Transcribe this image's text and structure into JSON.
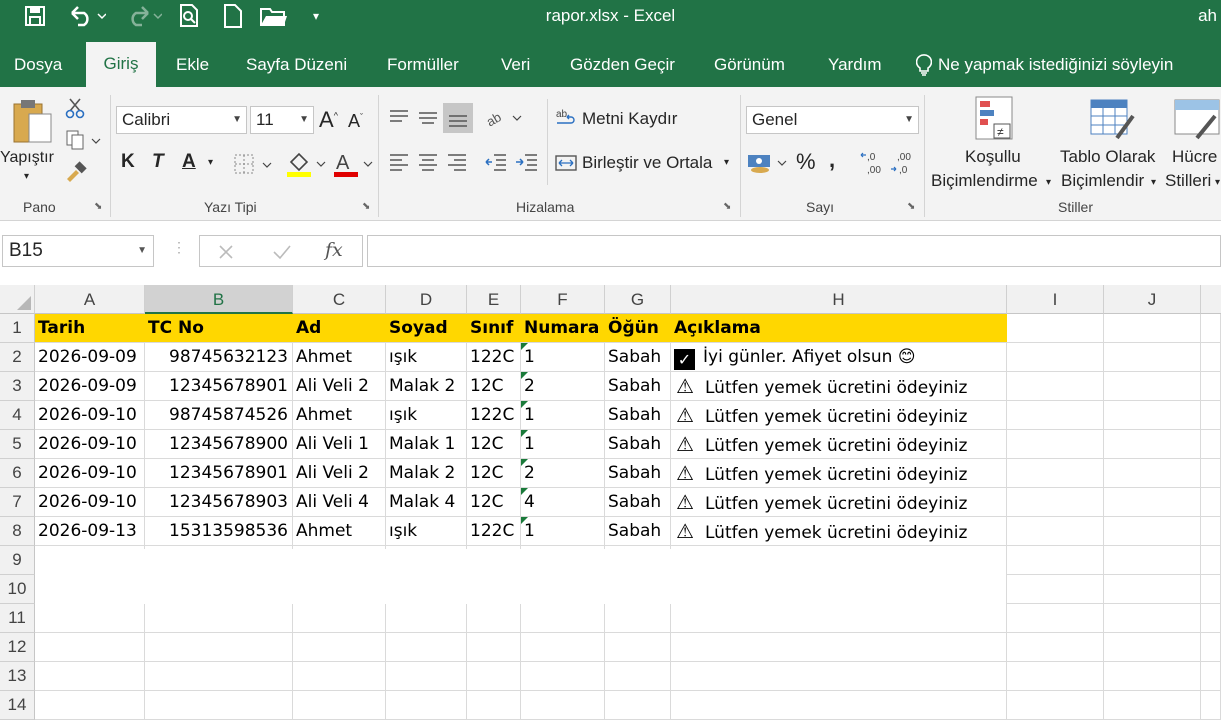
{
  "window": {
    "title": "rapor.xlsx  -  Excel",
    "user": "ah"
  },
  "tabs": [
    {
      "label": "Dosya"
    },
    {
      "label": "Giriş"
    },
    {
      "label": "Ekle"
    },
    {
      "label": "Sayfa Düzeni"
    },
    {
      "label": "Formüller"
    },
    {
      "label": "Veri"
    },
    {
      "label": "Gözden Geçir"
    },
    {
      "label": "Görünüm"
    },
    {
      "label": "Yardım"
    }
  ],
  "tell_me": "Ne yapmak istediğinizi söyleyin",
  "ribbon": {
    "clipboard": {
      "paste_label": "Yapıştır",
      "group_label": "Pano"
    },
    "font": {
      "name": "Calibri",
      "size": "11",
      "bold": "K",
      "italic": "T",
      "underline": "A",
      "group_label": "Yazı Tipi"
    },
    "alignment": {
      "wrap_text": "Metni Kaydır",
      "merge_center": "Birleştir ve Ortala",
      "group_label": "Hizalama"
    },
    "number": {
      "format": "Genel",
      "group_label": "Sayı"
    },
    "styles": {
      "conditional_line1": "Koşullu",
      "conditional_line2": "Biçimlendirme",
      "table_line1": "Tablo Olarak",
      "table_line2": "Biçimlendir",
      "cell_line1": "Hücre",
      "cell_line2": "Stilleri",
      "group_label": "Stiller"
    }
  },
  "formula_bar": {
    "name_box": "B15",
    "fx": "fx",
    "value": ""
  },
  "columns": [
    "A",
    "B",
    "C",
    "D",
    "E",
    "F",
    "G",
    "H",
    "I",
    "J"
  ],
  "selected_column": "B",
  "rows": [
    "1",
    "2",
    "3",
    "4",
    "5",
    "6",
    "7",
    "8",
    "9",
    "10",
    "11",
    "12",
    "13",
    "14"
  ],
  "header_row": [
    "Tarih",
    "TC No",
    "Ad",
    "Soyad",
    "Sınıf",
    "Numara",
    "Öğün",
    "Açıklama"
  ],
  "data_rows": [
    [
      "2026-09-09",
      "98745632123",
      "Ahmet",
      "ışık",
      "122C",
      "1",
      "Sabah",
      "İyi günler. Afiyet olsun 😊"
    ],
    [
      "2026-09-09",
      "12345678901",
      "Ali Veli 2",
      "Malak 2",
      "12C",
      "2",
      "Sabah",
      "Lütfen yemek ücretini ödeyiniz"
    ],
    [
      "2026-09-10",
      "98745874526",
      "Ahmet",
      "ışık",
      "122C",
      "1",
      "Sabah",
      "Lütfen yemek ücretini ödeyiniz"
    ],
    [
      "2026-09-10",
      "12345678900",
      "Ali Veli 1",
      "Malak 1",
      "12C",
      "1",
      "Sabah",
      "Lütfen yemek ücretini ödeyiniz"
    ],
    [
      "2026-09-10",
      "12345678901",
      "Ali Veli 2",
      "Malak 2",
      "12C",
      "2",
      "Sabah",
      "Lütfen yemek ücretini ödeyiniz"
    ],
    [
      "2026-09-10",
      "12345678903",
      "Ali Veli 4",
      "Malak 4",
      "12C",
      "4",
      "Sabah",
      "Lütfen yemek ücretini ödeyiniz"
    ],
    [
      "2026-09-13",
      "15313598536",
      "Ahmet",
      "ışık",
      "122C",
      "1",
      "Sabah",
      "Lütfen yemek ücretini ödeyiniz"
    ]
  ],
  "row_icons": [
    "check-icon",
    "warning-icon",
    "warning-icon",
    "warning-icon",
    "warning-icon",
    "warning-icon",
    "warning-icon"
  ],
  "colors": {
    "excel_green": "#217346",
    "header_fill": "#ffd700"
  }
}
